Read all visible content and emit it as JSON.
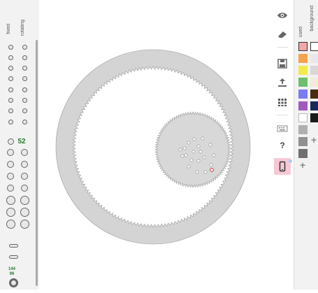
{
  "left_panel": {
    "col_fixed": "fixed",
    "col_rotating": "rotating",
    "selected_teeth": "52",
    "bottom_top_value": "144",
    "bottom_bottom_value": "96"
  },
  "palette": {
    "col_used": "used",
    "col_background": "background",
    "used_colors": [
      "#f4a7a7",
      "#f6a34e",
      "#f2ea4a",
      "#6cbf6c",
      "#7a7cf0",
      "#a05ac0",
      "#ffffff",
      "#b0b0b0",
      "#909090",
      "#707070"
    ],
    "bg_colors": [
      "#ffffff",
      "#e8e8e8",
      "#d8d8d8",
      "#f3ead8",
      "#4a2c10",
      "#1b2a5a",
      "#1a1a1a"
    ],
    "add_label": "+"
  },
  "tools": [
    "eye-icon",
    "eraser-icon",
    "save-icon",
    "upload-icon",
    "grid-icon",
    "keyboard-icon",
    "help-icon",
    "phone-icon"
  ],
  "help_label": "?"
}
